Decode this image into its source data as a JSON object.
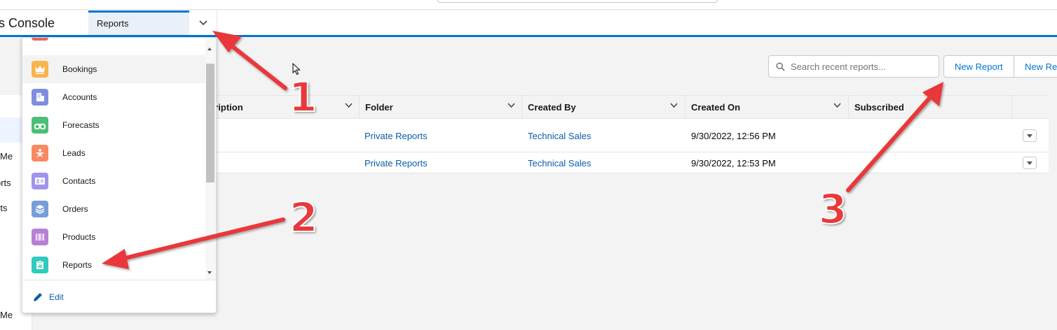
{
  "navbar": {
    "app_name": "s Console",
    "active_tab": "Reports"
  },
  "left_sidebar": {
    "labels": [
      "Me",
      "orts",
      "rts",
      "Me"
    ]
  },
  "toolbar": {
    "search_placeholder": "Search recent reports...",
    "new_report_label": "New Report",
    "new_report_2_label": "New Rep"
  },
  "table": {
    "columns": [
      "cription",
      "Folder",
      "Created By",
      "Created On",
      "Subscribed"
    ],
    "rows": [
      {
        "folder": "Private Reports",
        "created_by": "Technical Sales",
        "created_on": "9/30/2022, 12:56 PM"
      },
      {
        "folder": "Private Reports",
        "created_by": "Technical Sales",
        "created_on": "9/30/2022, 12:53 PM"
      }
    ]
  },
  "nav_menu": {
    "items": [
      {
        "label": "Bookings",
        "icon": "crown-icon",
        "color": "#f9b44e"
      },
      {
        "label": "Accounts",
        "icon": "building-icon",
        "color": "#7f8de1"
      },
      {
        "label": "Forecasts",
        "icon": "binoculars-icon",
        "color": "#4bc076"
      },
      {
        "label": "Leads",
        "icon": "lead-star-icon",
        "color": "#f88962"
      },
      {
        "label": "Contacts",
        "icon": "contact-card-icon",
        "color": "#a094ed"
      },
      {
        "label": "Orders",
        "icon": "stack-icon",
        "color": "#769ed9"
      },
      {
        "label": "Products",
        "icon": "barcode-icon",
        "color": "#b781d3"
      },
      {
        "label": "Reports",
        "icon": "report-clipboard-icon",
        "color": "#2ecbbe"
      }
    ],
    "edit_label": "Edit"
  },
  "annotations": {
    "numbers": [
      "1",
      "2",
      "3"
    ],
    "color": "#e8393b"
  }
}
